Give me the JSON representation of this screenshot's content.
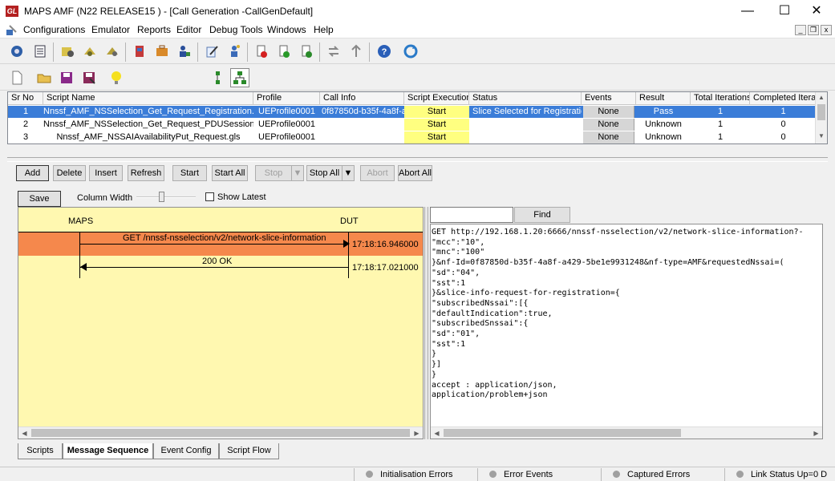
{
  "window": {
    "title": "MAPS AMF (N22 RELEASE15 ) - [Call Generation  -CallGenDefault]",
    "app_icon_text": "GL",
    "minimize_glyph": "—",
    "maximize_glyph": "☐",
    "close_glyph": "✕"
  },
  "menu": {
    "items": [
      "Configurations",
      "Emulator",
      "Reports",
      "Editor",
      "Debug Tools",
      "Windows",
      "Help"
    ],
    "mdi_min": "_",
    "mdi_restore": "❐",
    "mdi_close": "x"
  },
  "grid": {
    "headers": [
      "Sr No",
      "Script Name",
      "Profile",
      "Call Info",
      "Script Execution",
      "Status",
      "Events",
      "Result",
      "Total Iterations",
      "Completed Iteratio"
    ],
    "rows": [
      {
        "sr": "1",
        "script": "Nnssf_AMF_NSSelection_Get_Request_Registration.gls",
        "profile": "UEProfile0001",
        "callinfo": "0f87850d-b35f-4a8f-a...",
        "exec": "Start",
        "status": "Slice Selected for Registration",
        "events": "None",
        "result": "Pass",
        "total": "1",
        "completed": "1"
      },
      {
        "sr": "2",
        "script": "Nnssf_AMF_NSSelection_Get_Request_PDUSession.gls",
        "profile": "UEProfile0001",
        "callinfo": "",
        "exec": "Start",
        "status": "",
        "events": "None",
        "result": "Unknown",
        "total": "1",
        "completed": "0"
      },
      {
        "sr": "3",
        "script": "Nnssf_AMF_NSSAIAvailabilityPut_Request.gls",
        "profile": "UEProfile0001",
        "callinfo": "",
        "exec": "Start",
        "status": "",
        "events": "None",
        "result": "Unknown",
        "total": "1",
        "completed": "0"
      }
    ]
  },
  "actions": {
    "add": "Add",
    "delete": "Delete",
    "insert": "Insert",
    "refresh": "Refresh",
    "start": "Start",
    "start_all": "Start All",
    "stop": "Stop",
    "stop_all": "Stop All",
    "abort": "Abort",
    "abort_all": "Abort All"
  },
  "sequence_toolbar": {
    "save": "Save",
    "column_width": "Column Width",
    "show_latest": "Show Latest"
  },
  "sequence": {
    "left_entity": "MAPS",
    "right_entity": "DUT",
    "messages": [
      {
        "label": "GET /nnssf-nsselection/v2/network-slice-information",
        "time": "17:18:16.946000",
        "direction": "right"
      },
      {
        "label": "200 OK",
        "time": "17:18:17.021000",
        "direction": "left"
      }
    ]
  },
  "find": {
    "value": "",
    "button": "Find"
  },
  "message_lines": [
    "GET http://192.168.1.20:6666/nnssf-nsselection/v2/network-slice-information?-",
    "\"mcc\":\"10\",",
    "\"mnc\":\"100\"",
    "}&nf-Id=0f87850d-b35f-4a8f-a429-5be1e9931248&nf-type=AMF&requestedNssai=(",
    "\"sd\":\"04\",",
    "\"sst\":1",
    "}&slice-info-request-for-registration={",
    "\"subscribedNssai\":[{",
    "\"defaultIndication\":true,",
    "\"subscribedSnssai\":{",
    "\"sd\":\"01\",",
    "\"sst\":1",
    "}",
    "}]",
    "}",
    "accept : application/json,",
    "application/problem+json"
  ],
  "tabs": [
    "Scripts",
    "Message Sequence",
    "Event Config",
    "Script Flow"
  ],
  "status": {
    "items": [
      "Initialisation Errors",
      "Error Events",
      "Captured Errors",
      "Link Status Up=0 D"
    ]
  },
  "colors": {
    "selection": "#3b7dd8",
    "start_cell": "#ffff80",
    "sequence_bg": "#fff8b0",
    "highlight": "#f5884c"
  }
}
